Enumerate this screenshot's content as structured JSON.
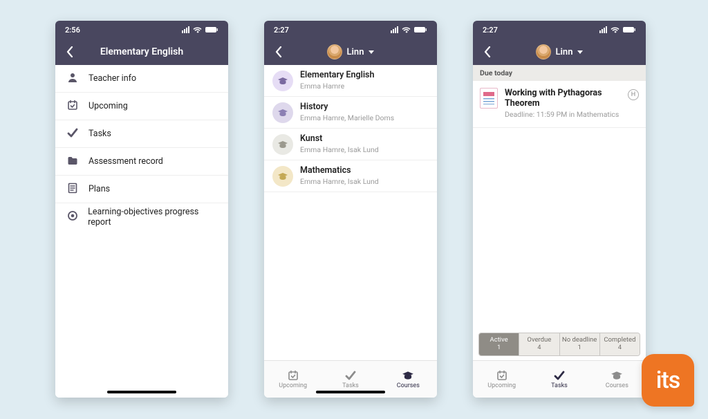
{
  "status": {
    "time1": "2:56",
    "time2": "2:27",
    "time3": "2:27"
  },
  "phone1": {
    "title": "Elementary English",
    "items": [
      {
        "icon": "user",
        "label": "Teacher info"
      },
      {
        "icon": "cal",
        "label": "Upcoming"
      },
      {
        "icon": "check",
        "label": "Tasks"
      },
      {
        "icon": "folder",
        "label": "Assessment record"
      },
      {
        "icon": "plan",
        "label": "Plans"
      },
      {
        "icon": "target",
        "label": "Learning-objectives progress report"
      }
    ]
  },
  "phone2": {
    "profile": "Linn",
    "courses": [
      {
        "color": "#e6ddf5",
        "title": "Elementary English",
        "sub": "Emma Hamre"
      },
      {
        "color": "#ded8ec",
        "title": "History",
        "sub": "Emma Hamre, Marielle Doms"
      },
      {
        "color": "#e9e9e4",
        "title": "Kunst",
        "sub": "Emma Hamre, Isak Lund"
      },
      {
        "color": "#f3e7c7",
        "title": "Mathematics",
        "sub": "Emma Hamre, Isak Lund"
      }
    ],
    "tabs": {
      "upcoming": "Upcoming",
      "tasks": "Tasks",
      "courses": "Courses"
    }
  },
  "phone3": {
    "profile": "Linn",
    "section": "Due today",
    "task": {
      "title": "Working with Pythagoras Theorem",
      "sub": "Deadline: 11:59 PM in Mathematics",
      "badge": "H"
    },
    "segments": [
      {
        "label": "Active",
        "count": "1",
        "active": true
      },
      {
        "label": "Overdue",
        "count": "4",
        "active": false
      },
      {
        "label": "No deadline",
        "count": "1",
        "active": false
      },
      {
        "label": "Completed",
        "count": "4",
        "active": false
      }
    ],
    "tabs": {
      "upcoming": "Upcoming",
      "tasks": "Tasks",
      "courses": "Courses"
    }
  },
  "logo": "its"
}
